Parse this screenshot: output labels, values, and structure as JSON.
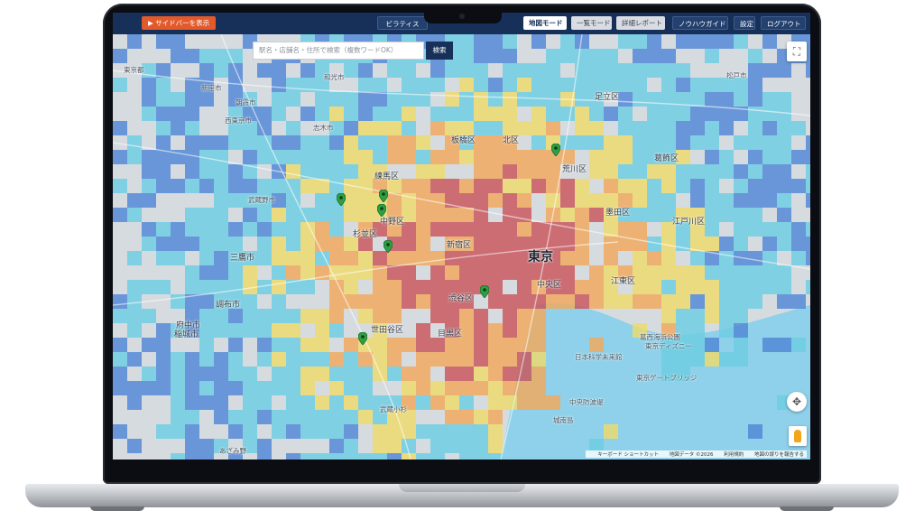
{
  "header": {
    "sidebar_button": "▶ サイドバーを表示",
    "buttons": [
      {
        "label": "ビラティス",
        "style": "dark"
      },
      {
        "label": "地図モード",
        "style": "active"
      },
      {
        "label": "一覧モード",
        "style": "ghost"
      },
      {
        "label": "詳細レポート",
        "style": "ghost"
      },
      {
        "label": "ノウハウガイド",
        "style": "dark"
      },
      {
        "label": "設定",
        "style": "dark"
      },
      {
        "label": "ログアウト",
        "style": "dark"
      }
    ]
  },
  "search": {
    "placeholder": "駅名・店舗名・住所で検索（複数ワードOK）",
    "button": "検索"
  },
  "map": {
    "places": [
      {
        "name": "東京",
        "cls": "big"
      },
      {
        "name": "練馬区",
        "cls": ""
      },
      {
        "name": "板橋区",
        "cls": ""
      },
      {
        "name": "北区",
        "cls": ""
      },
      {
        "name": "足立区",
        "cls": ""
      },
      {
        "name": "荒川区",
        "cls": ""
      },
      {
        "name": "葛飾区",
        "cls": ""
      },
      {
        "name": "中野区",
        "cls": ""
      },
      {
        "name": "杉並区",
        "cls": ""
      },
      {
        "name": "新宿区",
        "cls": ""
      },
      {
        "name": "墨田区",
        "cls": ""
      },
      {
        "name": "江戸川区",
        "cls": ""
      },
      {
        "name": "中央区",
        "cls": ""
      },
      {
        "name": "江東区",
        "cls": ""
      },
      {
        "name": "渋谷区",
        "cls": ""
      },
      {
        "name": "世田谷区",
        "cls": ""
      },
      {
        "name": "目黒区",
        "cls": ""
      },
      {
        "name": "三鷹市",
        "cls": ""
      },
      {
        "name": "調布市",
        "cls": ""
      },
      {
        "name": "府中市",
        "cls": ""
      },
      {
        "name": "稲城市",
        "cls": ""
      },
      {
        "name": "武蔵野市",
        "cls": "small"
      },
      {
        "name": "東京都",
        "cls": "small"
      },
      {
        "name": "新座市",
        "cls": "small"
      },
      {
        "name": "西東京市",
        "cls": "small"
      },
      {
        "name": "朝霞市",
        "cls": "small"
      },
      {
        "name": "和光市",
        "cls": "small"
      },
      {
        "name": "志木市",
        "cls": "small"
      },
      {
        "name": "松戸市",
        "cls": "small"
      },
      {
        "name": "日本科学未来館",
        "cls": "small"
      },
      {
        "name": "東京ゲートブリッジ",
        "cls": "small"
      },
      {
        "name": "東京ディズニー",
        "cls": "small"
      },
      {
        "name": "葛西海浜公園",
        "cls": "small"
      },
      {
        "name": "城南島",
        "cls": "small"
      },
      {
        "name": "中央防波堤",
        "cls": "small"
      },
      {
        "name": "あざみ野",
        "cls": "small"
      },
      {
        "name": "武蔵小杉",
        "cls": "small"
      }
    ],
    "pin_count": 7,
    "attribution": [
      "キーボード ショートカット",
      "地図データ ©2026",
      "利用規約",
      "地図の誤りを報告する"
    ],
    "colors": {
      "red": "#c8545a",
      "orange": "#f2a85a",
      "yellow": "#eedb6b",
      "cyan": "#6dcde3",
      "blue": "#4f86d6",
      "land": "#d6dbe0",
      "water": "#8fd1ea"
    }
  },
  "controls": {
    "fullscreen_icon": "fullscreen-icon",
    "zoom_icon": "zoom-icon",
    "pegman_icon": "pegman-icon"
  }
}
